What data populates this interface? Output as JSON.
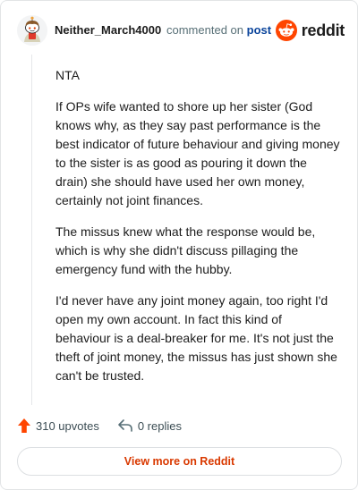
{
  "comment": {
    "author": "Neither_March4000",
    "action_text": "commented on",
    "post_link": "post",
    "brand": "reddit",
    "paragraphs": [
      "NTA",
      "If OPs wife wanted to shore up her sister (God knows why, as they say past performance is the best indicator of future behaviour and giving money to the sister is as good as pouring it down the drain) she should have used her own money, certainly not joint finances.",
      "The missus knew what the response would be, which is why she didn't discuss pillaging the emergency fund with the hubby.",
      "I'd never have any joint money again, too right I'd open my own account. In fact this kind of behaviour is a deal-breaker for me. It's not just the theft of joint money, the missus has just shown she can't be trusted."
    ],
    "upvotes": "310 upvotes",
    "replies": "0 replies",
    "view_more": "View more on Reddit"
  },
  "colors": {
    "brand_orange": "#ff4500",
    "link_blue": "#0a449b",
    "cta_text": "#d93900"
  },
  "icons": {
    "avatar": "snoo-avatar",
    "logo": "reddit-logo-icon",
    "upvote": "upvote-arrow-icon",
    "reply": "reply-arrow-icon"
  }
}
